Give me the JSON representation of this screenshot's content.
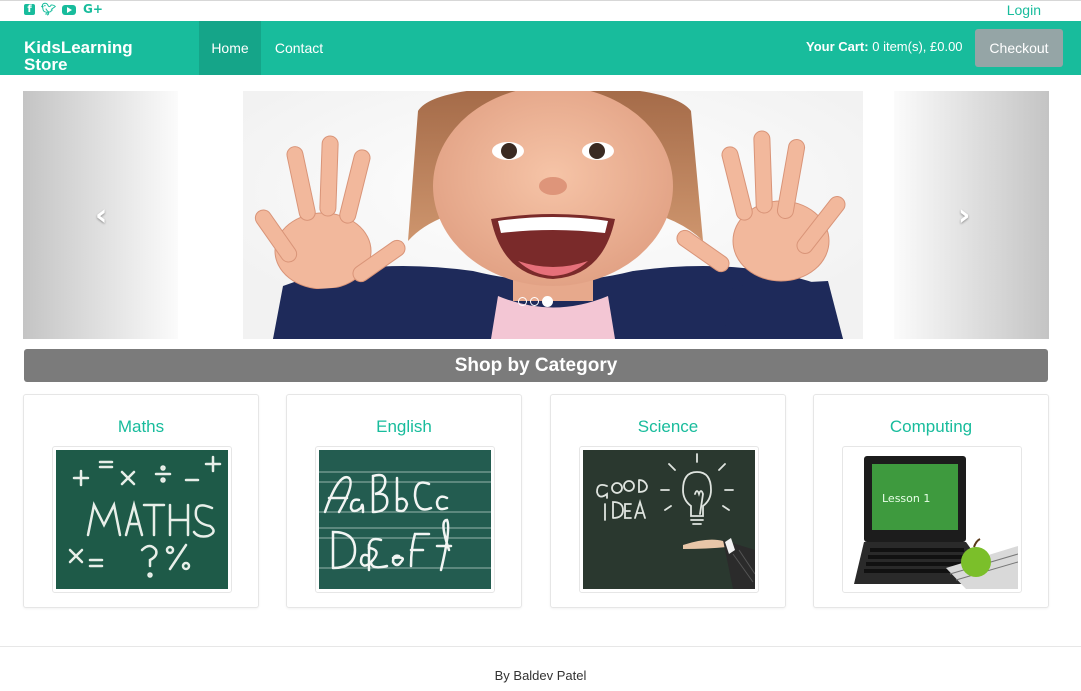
{
  "topbar": {
    "social_icons": [
      "facebook-icon",
      "twitter-icon",
      "youtube-icon",
      "google-plus-icon"
    ],
    "login_label": "Login"
  },
  "navbar": {
    "brand_line1": "KidsLearning",
    "brand_line2": "Store",
    "nav_items": [
      {
        "label": "Home",
        "active": true
      },
      {
        "label": "Contact",
        "active": false
      }
    ],
    "cart_label": "Your Cart:",
    "cart_value": " 0 item(s), £0.00",
    "checkout_label": "Checkout"
  },
  "carousel": {
    "prev_icon": "chevron-left-icon",
    "next_icon": "chevron-right-icon",
    "slide_count": 3,
    "active_slide": 3
  },
  "section": {
    "title": "Shop by Category"
  },
  "categories": [
    {
      "name": "Maths"
    },
    {
      "name": "English"
    },
    {
      "name": "Science"
    },
    {
      "name": "Computing"
    }
  ],
  "footer": {
    "text": "By Baldev Patel"
  },
  "colors": {
    "brand": "#18bc9c",
    "nav_active": "#15a589",
    "checkout": "#95a5a6",
    "section_bar": "#7b7b7b",
    "chalkboard": "#1f5a48"
  }
}
